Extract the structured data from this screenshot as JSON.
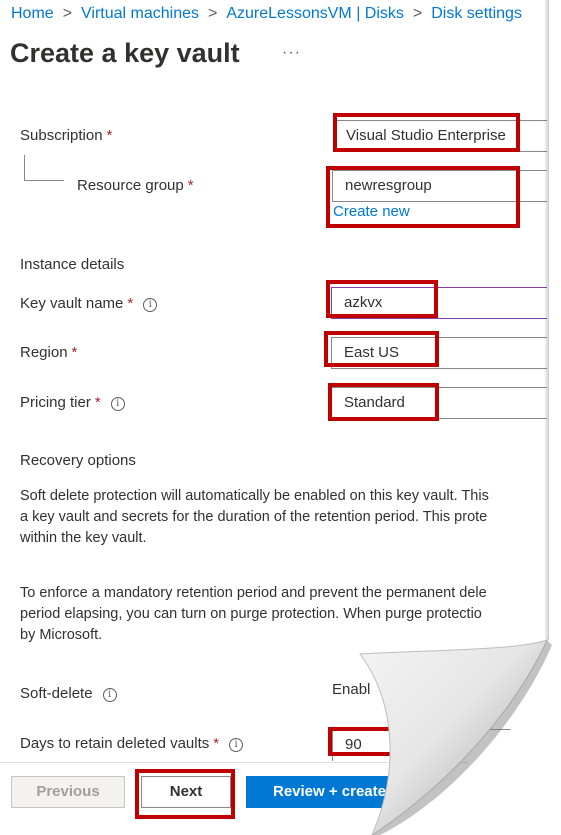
{
  "breadcrumb": {
    "items": [
      "Home",
      "Virtual machines",
      "AzureLessonsVM | Disks",
      "Disk settings"
    ]
  },
  "page": {
    "title": "Create a key vault",
    "more_label": "···"
  },
  "form": {
    "subscription": {
      "label": "Subscription",
      "required": "*",
      "value": "Visual Studio Enterprise"
    },
    "resource_group": {
      "label": "Resource group",
      "required": "*",
      "value": "newresgroup",
      "create_new": "Create new"
    },
    "instance_details": "Instance details",
    "key_vault_name": {
      "label": "Key vault name",
      "required": "*",
      "value": "azkvx"
    },
    "region": {
      "label": "Region",
      "required": "*",
      "value": "East US"
    },
    "pricing_tier": {
      "label": "Pricing tier",
      "required": "*",
      "value": "Standard"
    },
    "recovery_options": "Recovery options",
    "soft_delete_text": [
      "Soft delete protection will automatically be enabled on this key vault. This",
      "a key vault and secrets for the duration of the retention period. This prote",
      "within the key vault."
    ],
    "purge_text": [
      "To enforce a mandatory retention period and prevent the permanent dele",
      "period elapsing, you can turn on purge protection. When purge protectio",
      "by Microsoft."
    ],
    "soft_delete": {
      "label": "Soft-delete",
      "value": "Enabl"
    },
    "days_retain": {
      "label": "Days to retain deleted vaults",
      "required": "*",
      "value": "90"
    }
  },
  "footer": {
    "previous": "Previous",
    "next": "Next",
    "review_create": "Review + create"
  },
  "icons": {
    "info": "i",
    "info_icon_name": "info-icon"
  },
  "colors": {
    "link": "#0078d4",
    "highlight_box": "#c00000",
    "required": "#a4262c",
    "primary_button": "#0078d4"
  }
}
